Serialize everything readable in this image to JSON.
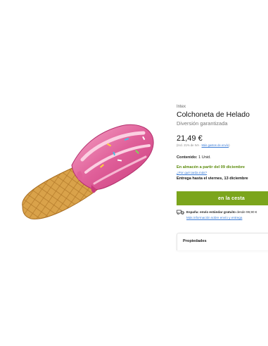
{
  "product": {
    "brand": "Intex",
    "title": "Colchoneta de Helado",
    "subtitle": "Diversión garantizada",
    "price": "21,49 €",
    "tax_note": "(Incl. 21% de IVA · ",
    "shipping_costs_link": "Más gastos de envío",
    "tax_note_end": ")",
    "content_label": "Contenido:",
    "content_value": "1 Unid.",
    "stock_status": "En almacén a partir del 09 diciembre",
    "stock_help_link": "¿Por qué tarda más?",
    "delivery": "Entrega hasta el viernes, 13 diciembre",
    "cart_button": "en la cesta",
    "shipping_bold": "España: envío estándar gratuito",
    "shipping_rest": " desde 99,90 €",
    "shipping_info_link": "Más información sobre envío y entrega",
    "properties_label": "Propiedades"
  },
  "colors": {
    "accent": "#7ba51c",
    "link": "#3a7bd5",
    "stock": "#5a8a0a",
    "cone": "#d9a24a",
    "icecream": "#e0609a"
  },
  "icons": {
    "shipping": "truck-icon"
  }
}
